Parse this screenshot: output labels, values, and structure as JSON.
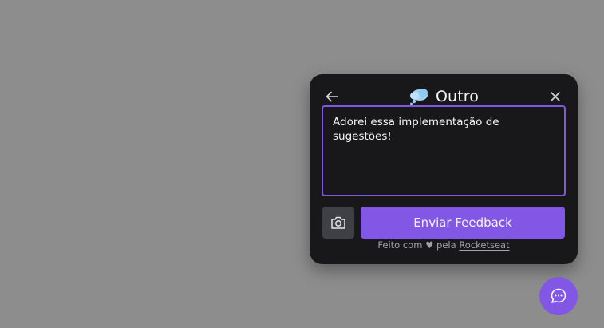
{
  "feedback_widget": {
    "title": "Outro",
    "type_icon": "thought-cloud-icon",
    "back_icon": "arrow-left-icon",
    "close_icon": "close-icon",
    "comment_value": "Adorei essa implementação de sugestões!",
    "screenshot_icon": "camera-icon",
    "submit_label": "Enviar Feedback",
    "footer": {
      "prefix": "Feito com ♥ pela ",
      "link_text": "Rocketseat"
    }
  },
  "launcher": {
    "icon": "chat-bubble-icon"
  },
  "colors": {
    "backdrop": "#8d8d8d",
    "panel": "#18181b",
    "accent": "#8257e5",
    "text": "#f4f4f5",
    "muted": "#a1a1aa",
    "secondary_button": "#3f3f46"
  }
}
